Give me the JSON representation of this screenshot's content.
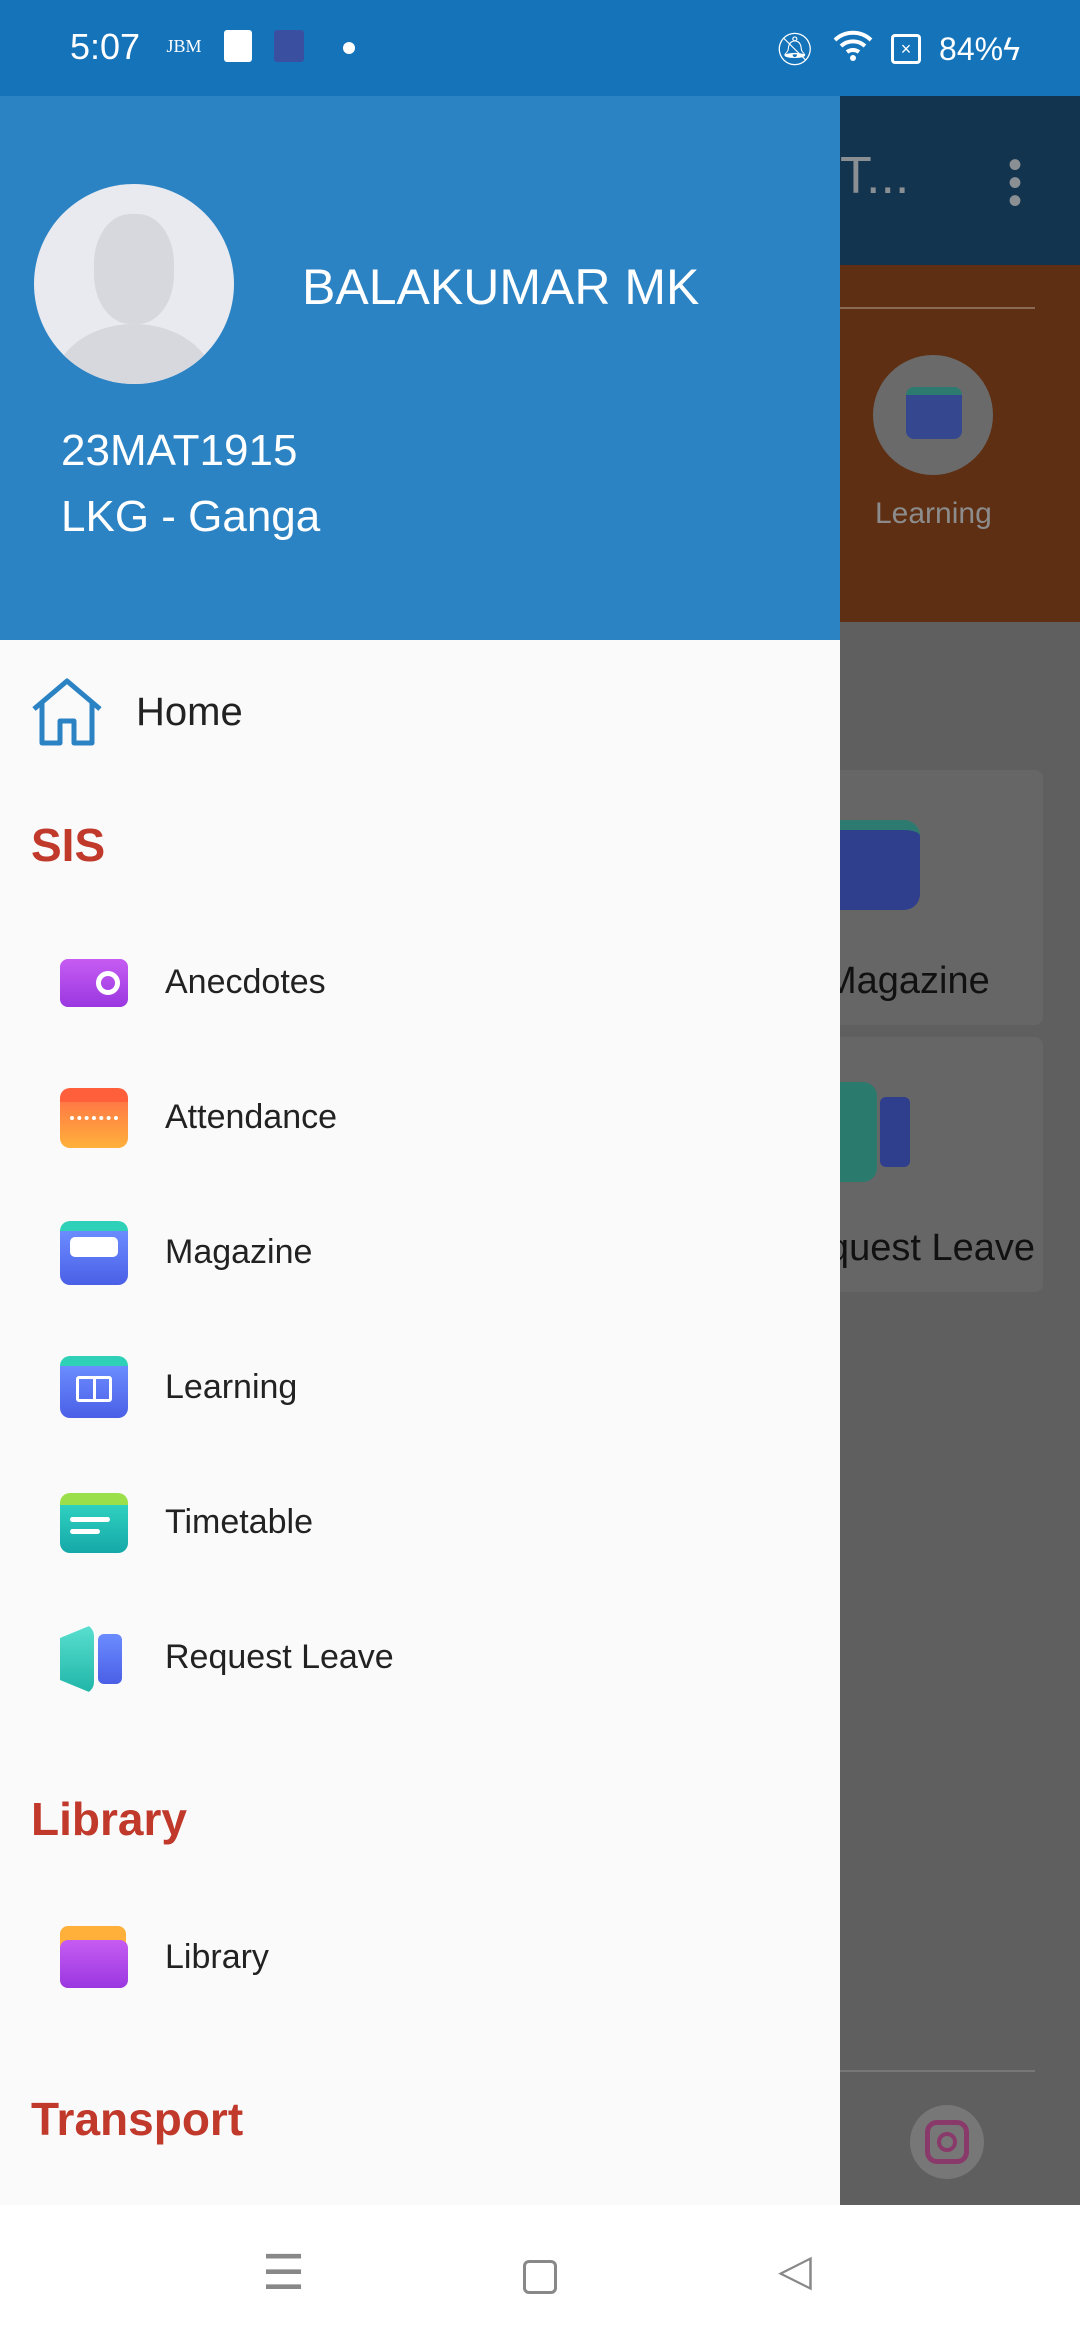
{
  "status_bar": {
    "time": "5:07",
    "battery": "84%",
    "notification_icons": [
      "jbm-school-icon",
      "app-icon",
      "school-building-icon",
      "dot-icon"
    ],
    "system_icons": [
      "bell-off-icon",
      "wifi-icon",
      "sim-off-icon",
      "charging-icon"
    ]
  },
  "drawer": {
    "header": {
      "name": "BALAKUMAR MK",
      "student_id": "23MAT1915",
      "class": "LKG - Ganga"
    },
    "home": {
      "label": "Home"
    },
    "sections": [
      {
        "title": "SIS",
        "items": [
          {
            "label": "Anecdotes",
            "icon": "camera-icon"
          },
          {
            "label": "Attendance",
            "icon": "calendar-icon"
          },
          {
            "label": "Magazine",
            "icon": "magazine-icon"
          },
          {
            "label": "Learning",
            "icon": "book-icon"
          },
          {
            "label": "Timetable",
            "icon": "timetable-icon"
          },
          {
            "label": "Request Leave",
            "icon": "door-icon"
          }
        ]
      },
      {
        "title": "Library",
        "items": [
          {
            "label": "Library",
            "icon": "folder-icon"
          }
        ]
      },
      {
        "title": "Transport",
        "items": []
      }
    ]
  },
  "background": {
    "title_fragment": "T...",
    "learning_label": "Learning",
    "cards": [
      "Magazine",
      "Request Leave"
    ]
  },
  "colors": {
    "status_bar": "#1473b9",
    "drawer_header": "#2c83c4",
    "section_title": "#c0392b"
  }
}
